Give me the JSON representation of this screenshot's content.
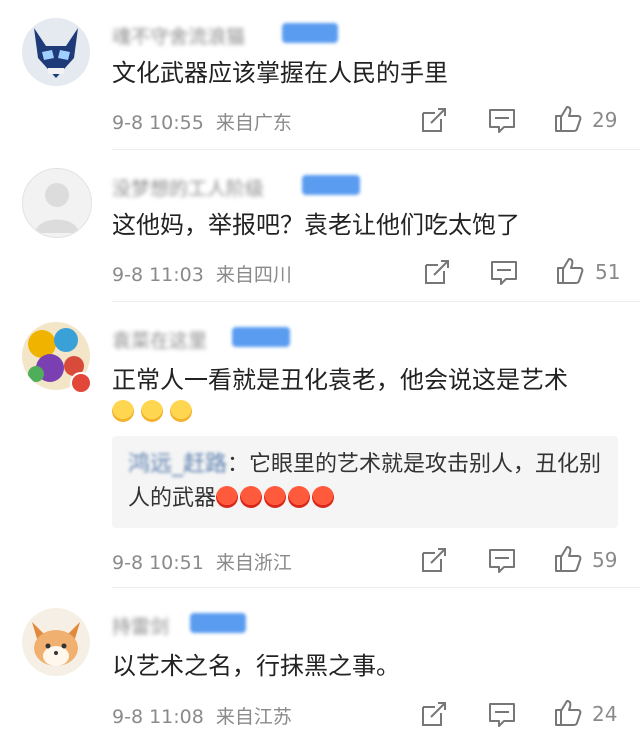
{
  "comments": [
    {
      "username": "魂不守舍流浪猫",
      "text": "文化武器应该掌握在人民的手里",
      "time": "9-8 10:55",
      "location": "来自广东",
      "likes": "29"
    },
    {
      "username": "没梦想的工人阶级",
      "text": "这他妈，举报吧？袁老让他们吃太饱了",
      "time": "9-8 11:03",
      "location": "来自四川",
      "likes": "51"
    },
    {
      "username": "袁菜在这里",
      "text": "正常人一看就是丑化袁老，他会说这是艺术",
      "time": "9-8 10:51",
      "location": "来自浙江",
      "likes": "59",
      "reply": {
        "name": "鸿远_赶路",
        "text": "：它眼里的艺术就是攻击别人，丑化别人的武器"
      }
    },
    {
      "username": "持雷剑",
      "text": "以艺术之名，行抹黑之事。",
      "time": "9-8 11:08",
      "location": "来自江苏",
      "likes": "24"
    }
  ],
  "icons": {
    "share": "share-icon",
    "comment": "comment-icon",
    "like": "thumbs-up-icon"
  },
  "colors": {
    "meta_gray": "#8a8a8a",
    "reply_bg": "#f5f5f5",
    "badge_blue": "#5a9cf0"
  }
}
